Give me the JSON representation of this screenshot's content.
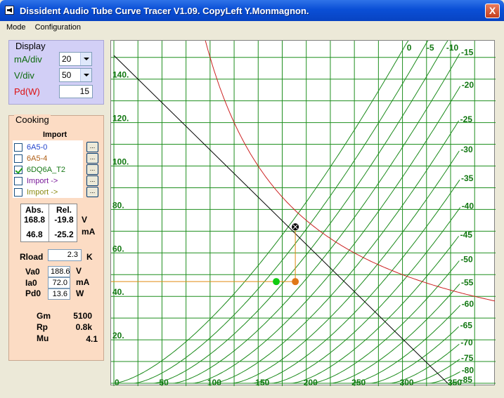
{
  "window": {
    "title": "Dissident Audio Tube Curve Tracer V1.09. CopyLeft Y.Monmagnon.",
    "close_label": "X"
  },
  "menu": [
    "Mode",
    "Configuration"
  ],
  "display": {
    "title": "Display",
    "ma_div_label": "mA/div",
    "ma_div_value": "20",
    "v_div_label": "V/div",
    "v_div_value": "50",
    "pd_label": "Pd(W)",
    "pd_value": "15"
  },
  "cooking": {
    "title": "Cooking",
    "import_header": "Import",
    "imports": [
      {
        "label": "6A5-0",
        "checked": false,
        "color": "#2244cc"
      },
      {
        "label": "6A5-4",
        "checked": false,
        "color": "#b06018"
      },
      {
        "label": "6DQ6A_T2",
        "checked": true,
        "color": "#1a7a1a"
      },
      {
        "label": "Import        ->",
        "checked": false,
        "color": "#7a1a9a"
      },
      {
        "label": "Import        ->",
        "checked": false,
        "color": "#8a8a10"
      }
    ],
    "dots_label": "...",
    "abs_label": "Abs.",
    "rel_label": "Rel.",
    "abs_v": "168.8",
    "rel_v": "-19.8",
    "v_unit": "V",
    "abs_ma": "46.8",
    "rel_ma": "-25.2",
    "ma_unit": "mA",
    "rload_label": "Rload",
    "rload_value": "2.3",
    "rload_unit": "K",
    "va0_label": "Va0",
    "va0_value": "188.6",
    "va0_unit": "V",
    "ia0_label": "Ia0",
    "ia0_value": "72.0",
    "ia0_unit": "mA",
    "pd0_label": "Pd0",
    "pd0_value": "13.6",
    "pd0_unit": "W",
    "gm_label": "Gm",
    "gm_value": "5100",
    "rp_label": "Rp",
    "rp_value": "0.8k",
    "mu_label": "Mu",
    "mu_value": "4.1"
  },
  "chart_data": {
    "type": "line",
    "xlim": [
      0,
      360
    ],
    "ylim": [
      0,
      160
    ],
    "x_ticks": [
      "0",
      "50",
      "100",
      "150",
      "200",
      "250",
      "300",
      "350"
    ],
    "y_ticks": [
      "20.",
      "40.",
      "60.",
      "80.",
      "100.",
      "120.",
      "140."
    ],
    "grid": true,
    "grid_labels": [
      "0",
      "-5",
      "-10",
      "-15",
      "-20",
      "-25",
      "-30",
      "-35",
      "-40",
      "-45",
      "-50",
      "-55",
      "-60",
      "-65",
      "-70",
      "-75",
      "-80",
      "-85"
    ],
    "grid_voltages": [
      0,
      -5,
      -10,
      -15,
      -20,
      -25,
      -30,
      -35,
      -40,
      -45,
      -50,
      -55,
      -60,
      -65,
      -70,
      -75,
      -80,
      -85
    ],
    "curve_color": "#1a8a1a",
    "load_line": {
      "x": [
        0,
        347
      ],
      "y": [
        150.9,
        0
      ],
      "color": "#000000"
    },
    "pd_max_watts": 15,
    "pd_color": "#cc2020",
    "operating_point": {
      "x": 188.6,
      "y": 72.0
    },
    "cursor_point": {
      "x": 168.8,
      "y": 46.8,
      "color": "#11cc11"
    },
    "quiescent_marker": {
      "x": 188.6,
      "y": 46.8,
      "color": "#e07818"
    },
    "guide_color": "#e08a10"
  }
}
